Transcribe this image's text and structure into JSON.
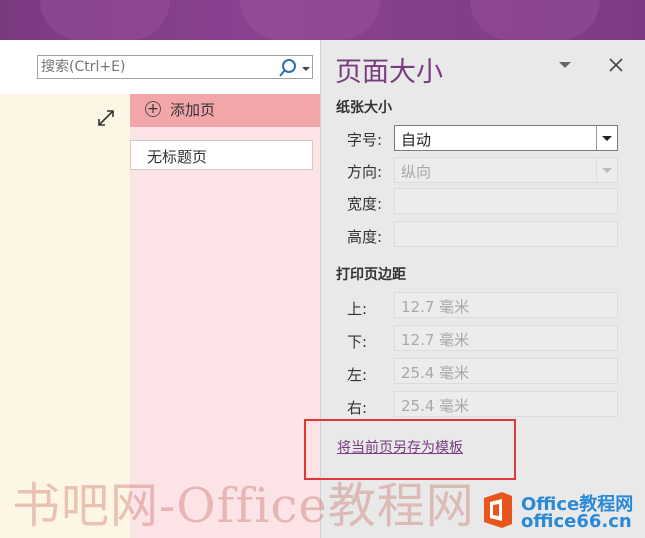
{
  "search": {
    "placeholder": "搜索(Ctrl+E)"
  },
  "pages": {
    "add_label": "添加页",
    "items": [
      {
        "label": "无标题页"
      }
    ]
  },
  "pane": {
    "title": "页面大小",
    "paper_section": "纸张大小",
    "size_label": "字号:",
    "size_value": "自动",
    "orientation_label": "方向:",
    "orientation_value": "纵向",
    "width_label": "宽度:",
    "height_label": "高度:",
    "margins_section": "打印页边距",
    "margins": [
      {
        "label": "上:",
        "value": "12.7 毫米"
      },
      {
        "label": "下:",
        "value": "12.7 毫米"
      },
      {
        "label": "左:",
        "value": "25.4 毫米"
      },
      {
        "label": "右:",
        "value": "25.4 毫米"
      }
    ],
    "save_template_link": "将当前页另存为模板"
  },
  "watermark": {
    "left_text": "书吧网-Office教程网",
    "brand_line1": "Office教程网",
    "brand_line2": "office66.cn"
  },
  "colors": {
    "accent": "#7b3b80",
    "titlebar": "#7a3a80",
    "note_bg": "#fdf6e4",
    "pages_bg": "#fbe3e6",
    "add_page_bg": "#f2a6a9",
    "pane_bg": "#e9e9e9",
    "highlight": "#e03838"
  }
}
